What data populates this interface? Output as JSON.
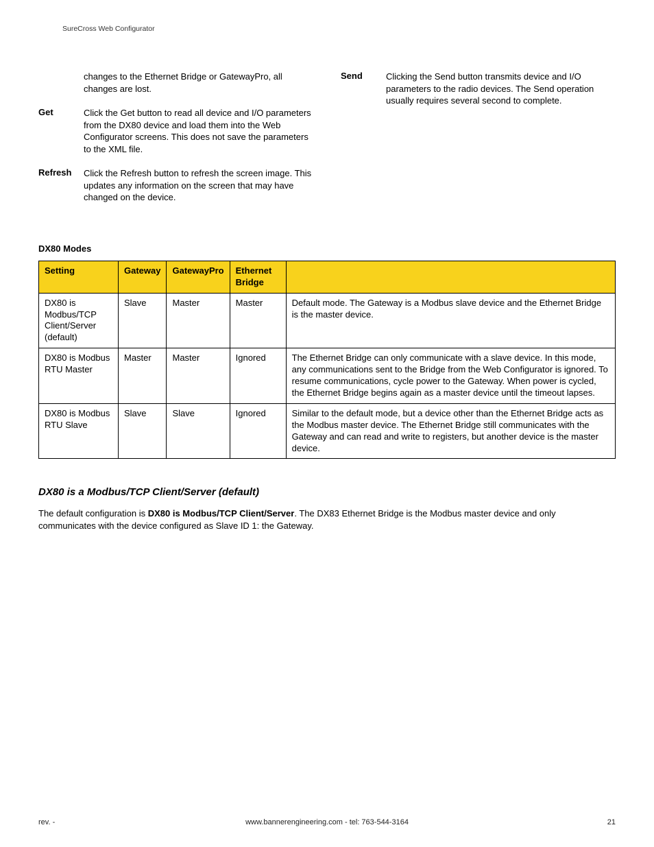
{
  "header": {
    "running": "SureCross Web Configurator"
  },
  "left_col": {
    "intro_cont": "changes to the Ethernet Bridge or GatewayPro, all changes are lost.",
    "get": {
      "term": "Get",
      "desc": "Click the Get button to read all device and I/O parameters from the DX80 device and load them into the Web Configurator screens. This does not save the parameters to the XML file."
    },
    "refresh": {
      "term": "Refresh",
      "desc": "Click the Refresh button to refresh the screen image. This updates any information on the screen that may have changed on the device."
    }
  },
  "right_col": {
    "send": {
      "term": "Send",
      "desc": "Clicking the Send button transmits device and I/O parameters to the radio devices. The Send operation usually requires several second to complete."
    }
  },
  "modes": {
    "heading": "DX80 Modes",
    "headers": {
      "setting": "Setting",
      "gateway": "Gateway",
      "gatewaypro": "GatewayPro",
      "eb": "Ethernet Bridge",
      "desc": ""
    },
    "rows": [
      {
        "setting": "DX80 is Modbus/TCP Client/Server (default)",
        "gateway": "Slave",
        "gatewaypro": "Master",
        "eb": "Master",
        "desc": "Default mode. The Gateway is a Modbus slave device and the Ethernet Bridge is the master device."
      },
      {
        "setting": "DX80 is Modbus RTU Master",
        "gateway": "Master",
        "gatewaypro": "Master",
        "eb": "Ignored",
        "desc": "The Ethernet Bridge can only communicate with a slave device. In this mode, any communications sent to the Bridge from the Web Configurator is ignored. To resume communications, cycle power to the Gateway. When power is cycled, the Ethernet Bridge begins again as a master device until the timeout lapses."
      },
      {
        "setting": "DX80 is Modbus RTU Slave",
        "gateway": "Slave",
        "gatewaypro": "Slave",
        "eb": "Ignored",
        "desc": "Similar to the default mode, but a device other than the Ethernet Bridge acts as the Modbus master device. The Ethernet Bridge still communicates with the Gateway and can read and write to registers, but another device is the master device."
      }
    ]
  },
  "sub": {
    "heading": "DX80 is a Modbus/TCP Client/Server (default)",
    "para_pre": "The default configuration is ",
    "para_bold": "DX80 is Modbus/TCP Client/Server",
    "para_post": ". The DX83 Ethernet Bridge is the Modbus master device and only communicates with the device configured as Slave ID 1: the Gateway."
  },
  "footer": {
    "rev": "rev. -",
    "contact": "www.bannerengineering.com - tel: 763-544-3164",
    "page": "21"
  }
}
